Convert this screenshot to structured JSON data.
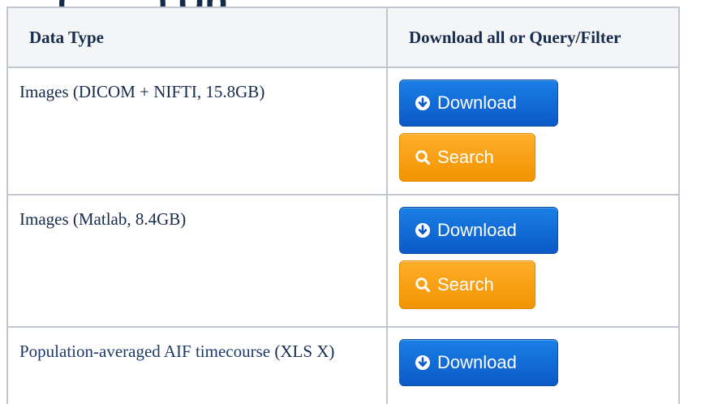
{
  "heading_fragment": "… (… …) Up…",
  "table": {
    "headers": {
      "data_type": "Data Type",
      "action": "Download all or Query/Filter"
    },
    "rows": [
      {
        "type_label": "Images (DICOM + NIFTI, 15.8GB)",
        "download_label": "Download",
        "search_label": "Search"
      },
      {
        "type_label": "Images (Matlab, 8.4GB)",
        "download_label": "Download",
        "search_label": "Search"
      },
      {
        "type_link": "Population-averaged AIF timecourse",
        "type_suffix": " (XLS X)",
        "download_label": "Download"
      }
    ]
  },
  "icons": {
    "download": "download-circle-icon",
    "search": "magnifier-icon"
  },
  "colors": {
    "download_button": "#0b66d6",
    "search_button": "#f7a01b",
    "text": "#172b4d",
    "link": "#1f3a68",
    "border": "#c1c7d0",
    "header_bg": "#f4f5f7"
  }
}
